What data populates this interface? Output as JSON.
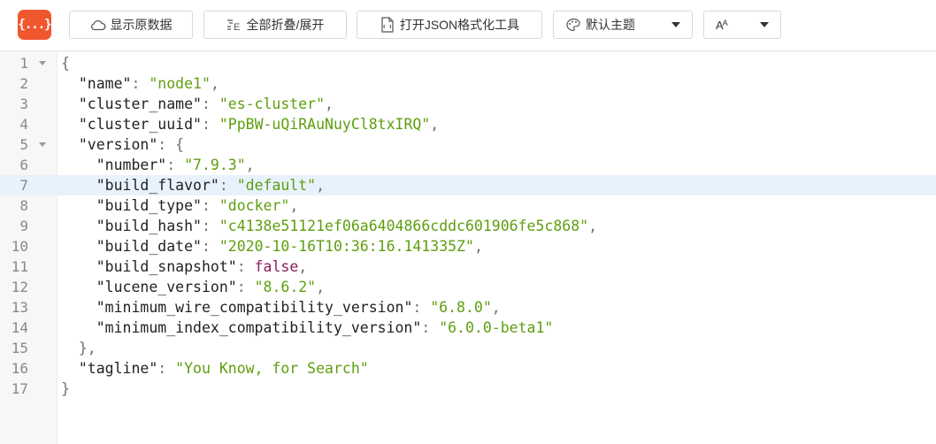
{
  "toolbar": {
    "logo_text": "{...}",
    "raw_label": "显示原数据",
    "fold_label": "全部折叠/展开",
    "open_label": "打开JSON格式化工具",
    "theme_label": "默认主题",
    "font_label": "AA"
  },
  "editor": {
    "active_line": 7,
    "lines": [
      {
        "n": "1",
        "fold": true,
        "indent": "",
        "parts": [
          [
            "p",
            "{"
          ]
        ]
      },
      {
        "n": "2",
        "fold": false,
        "indent": "  ",
        "parts": [
          [
            "k",
            "\"name\""
          ],
          [
            "p",
            ": "
          ],
          [
            "s",
            "\"node1\""
          ],
          [
            "p",
            ","
          ]
        ]
      },
      {
        "n": "3",
        "fold": false,
        "indent": "  ",
        "parts": [
          [
            "k",
            "\"cluster_name\""
          ],
          [
            "p",
            ": "
          ],
          [
            "s",
            "\"es-cluster\""
          ],
          [
            "p",
            ","
          ]
        ]
      },
      {
        "n": "4",
        "fold": false,
        "indent": "  ",
        "parts": [
          [
            "k",
            "\"cluster_uuid\""
          ],
          [
            "p",
            ": "
          ],
          [
            "s",
            "\"PpBW-uQiRAuNuyCl8txIRQ\""
          ],
          [
            "p",
            ","
          ]
        ]
      },
      {
        "n": "5",
        "fold": true,
        "indent": "  ",
        "parts": [
          [
            "k",
            "\"version\""
          ],
          [
            "p",
            ": {"
          ]
        ]
      },
      {
        "n": "6",
        "fold": false,
        "indent": "    ",
        "parts": [
          [
            "k",
            "\"number\""
          ],
          [
            "p",
            ": "
          ],
          [
            "s",
            "\"7.9.3\""
          ],
          [
            "p",
            ","
          ]
        ]
      },
      {
        "n": "7",
        "fold": false,
        "indent": "    ",
        "parts": [
          [
            "k",
            "\"build_flavor\""
          ],
          [
            "p",
            ": "
          ],
          [
            "s",
            "\"default\""
          ],
          [
            "p",
            ","
          ]
        ]
      },
      {
        "n": "8",
        "fold": false,
        "indent": "    ",
        "parts": [
          [
            "k",
            "\"build_type\""
          ],
          [
            "p",
            ": "
          ],
          [
            "s",
            "\"docker\""
          ],
          [
            "p",
            ","
          ]
        ]
      },
      {
        "n": "9",
        "fold": false,
        "indent": "    ",
        "parts": [
          [
            "k",
            "\"build_hash\""
          ],
          [
            "p",
            ": "
          ],
          [
            "s",
            "\"c4138e51121ef06a6404866cddc601906fe5c868\""
          ],
          [
            "p",
            ","
          ]
        ]
      },
      {
        "n": "10",
        "fold": false,
        "indent": "    ",
        "parts": [
          [
            "k",
            "\"build_date\""
          ],
          [
            "p",
            ": "
          ],
          [
            "s",
            "\"2020-10-16T10:36:16.141335Z\""
          ],
          [
            "p",
            ","
          ]
        ]
      },
      {
        "n": "11",
        "fold": false,
        "indent": "    ",
        "parts": [
          [
            "k",
            "\"build_snapshot\""
          ],
          [
            "p",
            ": "
          ],
          [
            "b",
            "false"
          ],
          [
            "p",
            ","
          ]
        ]
      },
      {
        "n": "12",
        "fold": false,
        "indent": "    ",
        "parts": [
          [
            "k",
            "\"lucene_version\""
          ],
          [
            "p",
            ": "
          ],
          [
            "s",
            "\"8.6.2\""
          ],
          [
            "p",
            ","
          ]
        ]
      },
      {
        "n": "13",
        "fold": false,
        "indent": "    ",
        "parts": [
          [
            "k",
            "\"minimum_wire_compatibility_version\""
          ],
          [
            "p",
            ": "
          ],
          [
            "s",
            "\"6.8.0\""
          ],
          [
            "p",
            ","
          ]
        ]
      },
      {
        "n": "14",
        "fold": false,
        "indent": "    ",
        "parts": [
          [
            "k",
            "\"minimum_index_compatibility_version\""
          ],
          [
            "p",
            ": "
          ],
          [
            "s",
            "\"6.0.0-beta1\""
          ]
        ]
      },
      {
        "n": "15",
        "fold": false,
        "indent": "  ",
        "parts": [
          [
            "p",
            "},"
          ]
        ]
      },
      {
        "n": "16",
        "fold": false,
        "indent": "  ",
        "parts": [
          [
            "k",
            "\"tagline\""
          ],
          [
            "p",
            ": "
          ],
          [
            "s",
            "\"You Know, for Search\""
          ]
        ]
      },
      {
        "n": "17",
        "fold": false,
        "indent": "",
        "parts": [
          [
            "p",
            "}"
          ]
        ]
      }
    ]
  },
  "colors": {
    "logo_bg": "#f0572f",
    "string": "#5e9e0f",
    "boolean": "#8b1f5c",
    "active_line_bg": "#e8f2fd"
  }
}
